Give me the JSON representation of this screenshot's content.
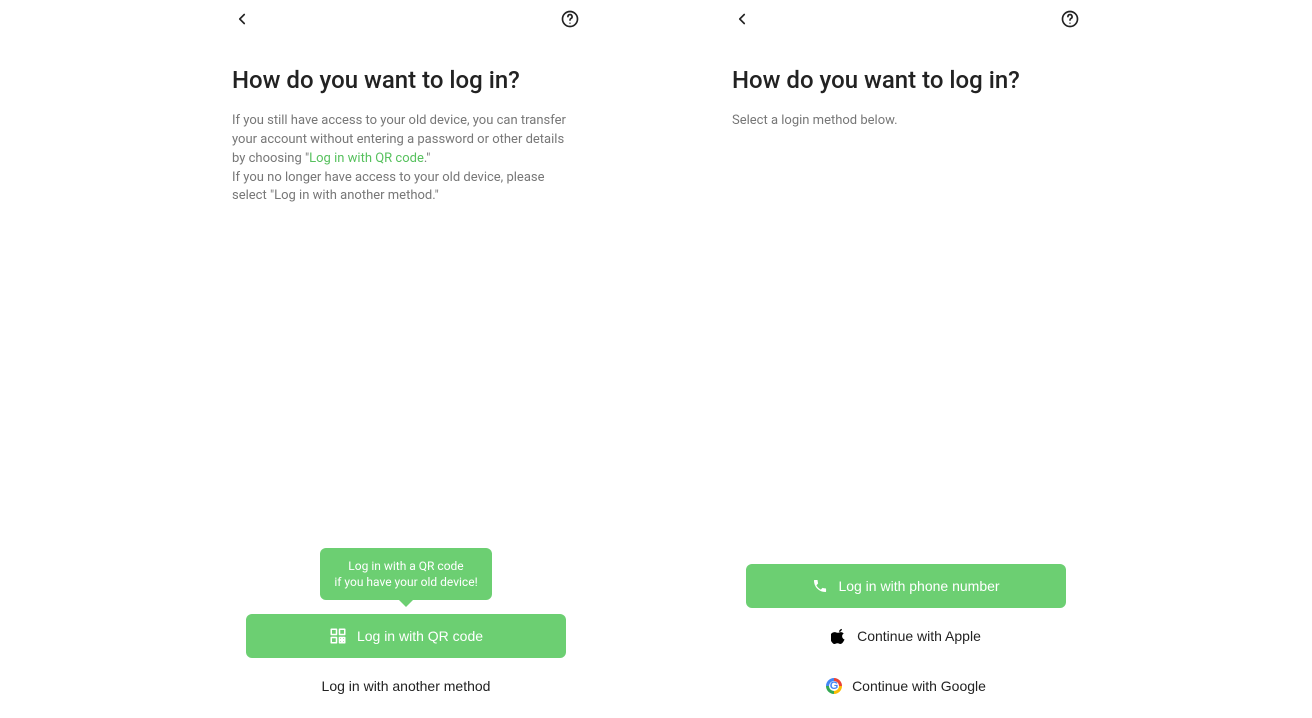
{
  "left": {
    "title": "How do you want to log in?",
    "desc1a": "If you still have access to your old device, you can transfer your account without entering a password or other details by choosing \"",
    "desc1_link": "Log in with QR code",
    "desc1b": ".\"",
    "desc2": "If you no longer have access to your old device, please select \"Log in with another method.\"",
    "tooltip_l1": "Log in with a QR code",
    "tooltip_l2": "if you have your old device!",
    "btn_qr": "Log in with QR code",
    "btn_other": "Log in with another method"
  },
  "right": {
    "title": "How do you want to log in?",
    "desc": "Select a login method below.",
    "btn_phone": "Log in with phone number",
    "btn_apple": "Continue with Apple",
    "btn_google": "Continue with Google"
  }
}
